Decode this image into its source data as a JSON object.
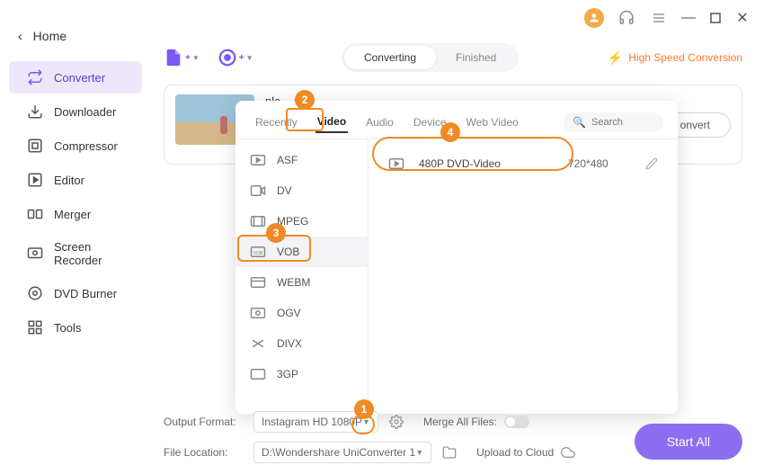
{
  "titlebar": {
    "user": "user"
  },
  "home": {
    "label": "Home"
  },
  "nav": [
    {
      "id": "converter",
      "label": "Converter",
      "active": true
    },
    {
      "id": "downloader",
      "label": "Downloader"
    },
    {
      "id": "compressor",
      "label": "Compressor"
    },
    {
      "id": "editor",
      "label": "Editor"
    },
    {
      "id": "merger",
      "label": "Merger"
    },
    {
      "id": "screenrecorder",
      "label": "Screen Recorder"
    },
    {
      "id": "dvdburner",
      "label": "DVD Burner"
    },
    {
      "id": "tools",
      "label": "Tools"
    }
  ],
  "segment": {
    "converting": "Converting",
    "finished": "Finished"
  },
  "speed": {
    "label": "High Speed Conversion"
  },
  "card": {
    "title": "ple",
    "convert": "onvert"
  },
  "popup": {
    "tabs": {
      "recently": "Recently",
      "video": "Video",
      "audio": "Audio",
      "device": "Device",
      "webvideo": "Web Video"
    },
    "search_placeholder": "Search",
    "formats": [
      "ASF",
      "DV",
      "MPEG",
      "VOB",
      "WEBM",
      "OGV",
      "DIVX",
      "3GP"
    ],
    "selected_format_index": 3,
    "result": {
      "label": "480P DVD-Video",
      "res": "720*480"
    }
  },
  "annotations": {
    "a1": "1",
    "a2": "2",
    "a3": "3",
    "a4": "4"
  },
  "footer": {
    "output_label": "Output Format:",
    "output_value": "Instagram HD 1080P",
    "location_label": "File Location:",
    "location_value": "D:\\Wondershare UniConverter 1",
    "merge_label": "Merge All Files:",
    "upload_label": "Upload to Cloud",
    "start_all": "Start All"
  }
}
